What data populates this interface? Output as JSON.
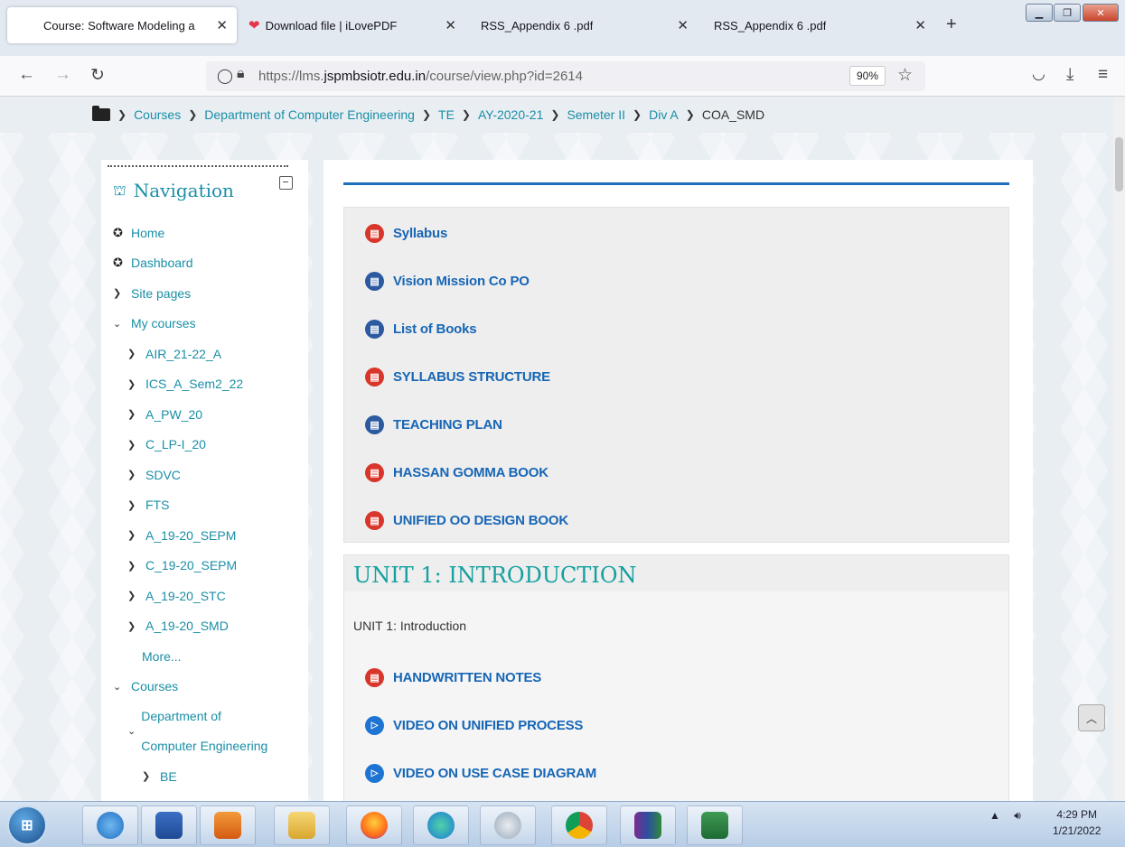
{
  "browser": {
    "tabs": [
      {
        "title": "Course: Software Modeling a",
        "active": true
      },
      {
        "title": "Download file | iLovePDF",
        "active": false
      },
      {
        "title": "RSS_Appendix 6 .pdf",
        "active": false
      },
      {
        "title": "RSS_Appendix 6 .pdf",
        "active": false
      }
    ],
    "url_host_prefix": "https://lms.",
    "url_host_main": "jspmbsiotr.edu.in",
    "url_path": "/course/view.php?id=2614",
    "zoom": "90%"
  },
  "breadcrumb": [
    "Courses",
    "Department of Computer Engineering",
    "TE",
    "AY-2020-21",
    "Semeter II",
    "Div A",
    "COA_SMD"
  ],
  "navigation": {
    "title": "Navigation",
    "items": [
      {
        "label": "Home",
        "glyph": "home"
      },
      {
        "label": "Dashboard",
        "glyph": "dashboard"
      },
      {
        "label": "Site pages",
        "glyph": "chevron-right"
      },
      {
        "label": "My courses",
        "glyph": "chevron-down"
      },
      {
        "label": "AIR_21-22_A"
      },
      {
        "label": "ICS_A_Sem2_22"
      },
      {
        "label": "A_PW_20"
      },
      {
        "label": "C_LP-I_20"
      },
      {
        "label": "SDVC"
      },
      {
        "label": "FTS"
      },
      {
        "label": "A_19-20_SEPM"
      },
      {
        "label": "C_19-20_SEPM"
      },
      {
        "label": "A_19-20_STC"
      },
      {
        "label": "A_19-20_SMD"
      },
      {
        "label": "More..."
      },
      {
        "label": "Courses"
      },
      {
        "label": "Department of Computer Engineering"
      },
      {
        "label": "BE"
      }
    ]
  },
  "section0": {
    "activities": [
      {
        "label": "Syllabus",
        "type": "pdf"
      },
      {
        "label": "Vision Mission Co PO",
        "type": "doc"
      },
      {
        "label": "List of Books",
        "type": "doc"
      },
      {
        "label": "SYLLABUS STRUCTURE",
        "type": "pdf"
      },
      {
        "label": "TEACHING PLAN",
        "type": "doc"
      },
      {
        "label": "HASSAN GOMMA BOOK",
        "type": "pdf"
      },
      {
        "label": "UNIFIED OO DESIGN BOOK",
        "type": "pdf"
      }
    ]
  },
  "unit1": {
    "title": "UNIT 1: INTRODUCTION",
    "summary": "UNIT 1: Introduction",
    "activities": [
      {
        "label": "HANDWRITTEN NOTES",
        "type": "pdf"
      },
      {
        "label": "VIDEO ON UNIFIED PROCESS",
        "type": "video"
      },
      {
        "label": "VIDEO ON USE CASE DIAGRAM",
        "type": "video"
      }
    ]
  },
  "taskbar": {
    "time": "4:29 PM",
    "date": "1/21/2022"
  },
  "colors": {
    "link": "#1a8fa6",
    "activity_link": "#1766b5",
    "pdf_icon": "#d9362b",
    "doc_icon": "#2c5aa0",
    "unit_title": "#14a09f"
  }
}
